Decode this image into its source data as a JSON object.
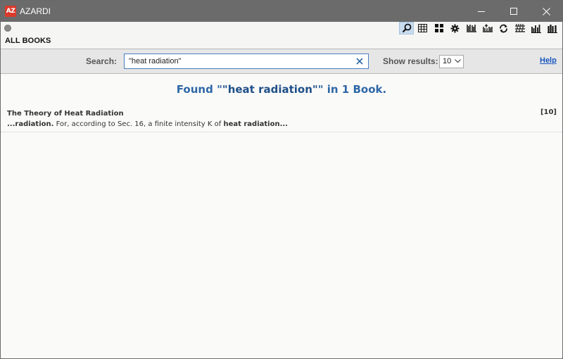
{
  "window": {
    "app_title": "AZARDI",
    "logo_text": "AZ"
  },
  "header": {
    "section_title": "ALL BOOKS"
  },
  "toolbar": {
    "icons": [
      "search-icon",
      "grid-view-icon",
      "tiles-view-icon",
      "settings-gear-icon",
      "library-shelf-icon",
      "bookshelf-add-icon",
      "sync-icon",
      "library-list-icon",
      "library-stats-icon",
      "library-books-icon"
    ],
    "active": "search-icon"
  },
  "search": {
    "label": "Search:",
    "value": "\"heat radiation\"",
    "show_results_label": "Show results:",
    "show_results_value": "10",
    "help_label": "Help"
  },
  "results": {
    "found_prefix": "Found ",
    "found_query_open": "\"",
    "found_query_term": "\"heat radiation\"",
    "found_query_close": "\"",
    "found_suffix": " in 1 Book.",
    "items": [
      {
        "title": "The Theory of Heat Radiation",
        "count": "[10]",
        "snippet_lead_bold": "...radiation.",
        "snippet_text": " For, according to Sec. 16, a finite intensity K of ",
        "snippet_tail_bold": "heat radiation..."
      }
    ]
  },
  "colors": {
    "titlebar": "#6b6b6b",
    "accent_blue": "#2e67a7",
    "link_blue": "#1a55c0",
    "logo_red": "#d93a2b"
  }
}
